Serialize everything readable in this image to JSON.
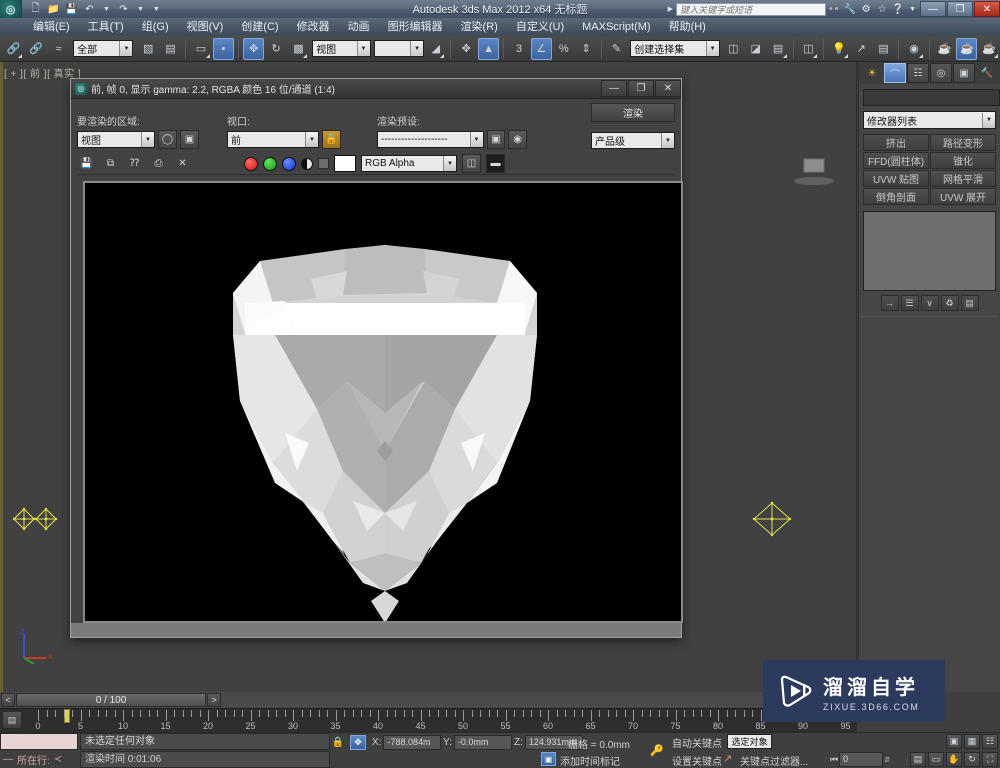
{
  "titlebar": {
    "app_title": "Autodesk 3ds Max  2012 x64",
    "document": "无标题",
    "search_placeholder": "键入关键字或短语",
    "quick_access": [
      "new-icon",
      "open-icon",
      "save-icon",
      "undo-icon",
      "redo-icon",
      "customize-icon"
    ],
    "help_icons": [
      "binoculars-icon",
      "wrench-icon",
      "subscription-icon",
      "star-icon",
      "help-icon"
    ],
    "window_buttons": {
      "minimize": "—",
      "maximize": "❐",
      "close": "✕"
    }
  },
  "menubar": {
    "items": [
      {
        "label": "编辑(E)"
      },
      {
        "label": "工具(T)"
      },
      {
        "label": "组(G)"
      },
      {
        "label": "视图(V)"
      },
      {
        "label": "创建(C)"
      },
      {
        "label": "修改器"
      },
      {
        "label": "动画"
      },
      {
        "label": "图形编辑器"
      },
      {
        "label": "渲染(R)"
      },
      {
        "label": "自定义(U)"
      },
      {
        "label": "MAXScript(M)"
      },
      {
        "label": "帮助(H)"
      }
    ]
  },
  "toolbar": {
    "selection_filter": "全部",
    "reference_coord": "视图",
    "named_selection_set": "创建选择集",
    "angle_snap_value": "3",
    "buttons": [
      {
        "name": "select-and-link-icon",
        "glyph": "⛓"
      },
      {
        "name": "unlink-selection-icon",
        "glyph": "⛓"
      },
      {
        "name": "bind-to-space-warp-icon",
        "glyph": "≈"
      },
      {
        "name": "select-object-icon",
        "glyph": "⬕"
      },
      {
        "name": "select-by-name-icon",
        "glyph": "⬓"
      },
      {
        "name": "rectangular-selection-region-icon",
        "glyph": "▭"
      },
      {
        "name": "window-crossing-icon",
        "glyph": "◪"
      },
      {
        "name": "select-and-move-icon",
        "glyph": "✥"
      },
      {
        "name": "select-and-rotate-icon",
        "glyph": "↻"
      },
      {
        "name": "select-and-scale-icon",
        "glyph": "⬓"
      },
      {
        "name": "use-pivot-center-icon",
        "glyph": "✥"
      },
      {
        "name": "use-selection-center-icon",
        "glyph": "⬘"
      },
      {
        "name": "snap-toggle-icon",
        "glyph": "⌗"
      },
      {
        "name": "angle-snap-toggle-icon",
        "glyph": "∡"
      },
      {
        "name": "percent-snap-toggle-icon",
        "glyph": "%"
      },
      {
        "name": "spinner-snap-toggle-icon",
        "glyph": "⇕"
      },
      {
        "name": "edit-named-selection-icon",
        "glyph": "✎"
      },
      {
        "name": "mirror-icon",
        "glyph": "◧"
      },
      {
        "name": "align-icon",
        "glyph": "⊨"
      },
      {
        "name": "layer-manager-icon",
        "glyph": "▤"
      },
      {
        "name": "curve-editor-icon",
        "glyph": "📈"
      },
      {
        "name": "schematic-view-icon",
        "glyph": "▦"
      },
      {
        "name": "material-editor-icon",
        "glyph": "◍"
      },
      {
        "name": "render-setup-icon",
        "glyph": "⛁"
      },
      {
        "name": "rendered-frame-window-icon",
        "glyph": "🫖"
      },
      {
        "name": "render-production-icon",
        "glyph": "🫖"
      }
    ]
  },
  "viewport": {
    "label": "[ + ][ 前 ][ 真实 ]",
    "gizmo_left_name": "target-light-gizmo",
    "gizmo_right_name": "target-light-gizmo",
    "axis_tripod": {
      "x": "X",
      "y": "Y",
      "z": "Z"
    }
  },
  "render_window": {
    "title": "前, 帧 0, 显示 gamma: 2.2, RGBA 颜色 16 位/通道 (1:4)",
    "window_buttons": {
      "minimize": "—",
      "maximize": "❐",
      "close": "✕"
    },
    "area_to_render_label": "要渲染的区域:",
    "area_to_render_value": "视图",
    "viewport_label": "视口:",
    "viewport_value": "前",
    "preset_label": "渲染预设:",
    "preset_value": "--------------------",
    "render_button": "渲染",
    "level_value": "产品级",
    "channel_value": "RGB Alpha",
    "toolbar_icons": [
      {
        "name": "save-image-icon",
        "glyph": "▤"
      },
      {
        "name": "copy-image-icon",
        "glyph": "⧉"
      },
      {
        "name": "clone-rendered-frame-icon",
        "glyph": "⁑"
      },
      {
        "name": "print-image-icon",
        "glyph": "⎙"
      },
      {
        "name": "clear-icon",
        "glyph": "✕"
      }
    ],
    "channel_toggles": [
      "red-channel-icon",
      "green-channel-icon",
      "blue-channel-icon",
      "alpha-channel-icon",
      "monochrome-icon"
    ],
    "view_icons": [
      "toggle-ui-icon",
      "display-alpha-icon"
    ],
    "image": {
      "subject": "faceted-diamond-render",
      "background": "#000000",
      "gem_highlight": "#ffffff",
      "gem_midtone": "#bdbdbd",
      "gem_shadow": "#8f8f8f"
    }
  },
  "command_panel": {
    "tabs": [
      {
        "name": "create-tab",
        "glyph": "✸"
      },
      {
        "name": "modify-tab",
        "glyph": "⌒"
      },
      {
        "name": "hierarchy-tab",
        "glyph": "⛬"
      },
      {
        "name": "motion-tab",
        "glyph": "◎"
      },
      {
        "name": "display-tab",
        "glyph": "▣"
      },
      {
        "name": "utilities-tab",
        "glyph": "🔨"
      }
    ],
    "object_name": "",
    "object_color": "#e5a8b6",
    "modifier_list_label": "修改器列表",
    "modifier_buttons": [
      "挤出",
      "路径变形",
      "FFD(圆柱体)",
      "锥化",
      "UVW 贴图",
      "网格平滑",
      "倒角剖面",
      "UVW 展开"
    ],
    "stack_buttons": [
      {
        "name": "pin-stack-icon",
        "glyph": "→|"
      },
      {
        "name": "show-end-result-icon",
        "glyph": "⫿⫾"
      },
      {
        "name": "make-unique-icon",
        "glyph": "⋎"
      },
      {
        "name": "remove-modifier-icon",
        "glyph": "⌫"
      },
      {
        "name": "configure-modifier-sets-icon",
        "glyph": "▤"
      }
    ]
  },
  "time_slider": {
    "current": "0 / 100",
    "prev_label": "<",
    "next_label": ">"
  },
  "track_bar": {
    "key_mode_icon": "open-mini-curve-editor-icon",
    "ticks": [
      0,
      5,
      10,
      15,
      20,
      25,
      30,
      35,
      40,
      45,
      50,
      55,
      60,
      65,
      70,
      75,
      80,
      85,
      90,
      95
    ]
  },
  "status_bar": {
    "minilistener_line": "所在行:",
    "minilistener_prefix": "—",
    "minilistener_suffix": "≺",
    "prompt": "未选定任何对象",
    "render_time": "渲染时间  0:01:06",
    "lock_icon": "lock-selection-icon",
    "transform_icon": "absolute-relative-transform-icon",
    "coords": [
      {
        "axis": "X:",
        "value": "-788.084m"
      },
      {
        "axis": "Y:",
        "value": "-0.0mm"
      },
      {
        "axis": "Z:",
        "value": "124.931mm"
      }
    ],
    "grid_text": "栅格 = 0.0mm",
    "add_time_tag": "添加时间标记",
    "auto_key": "自动关键点",
    "selected_object": "选定对象",
    "set_key": "设置关键点",
    "key_filters": "关键点过滤器...",
    "key_frame_value": "0",
    "nav_icons_top": [
      "zoom-icon",
      "zoom-all-icon",
      "zoom-extents-icon"
    ],
    "nav_icons_bottom": [
      "zoom-region-icon",
      "field-of-view-icon",
      "pan-icon",
      "orbit-icon",
      "maximize-viewport-icon"
    ]
  },
  "watermark": {
    "cn": "溜溜自学",
    "en": "ZIXUE.3D66.COM",
    "bg": "#2c3a5e",
    "logo_name": "play-button-logo"
  }
}
